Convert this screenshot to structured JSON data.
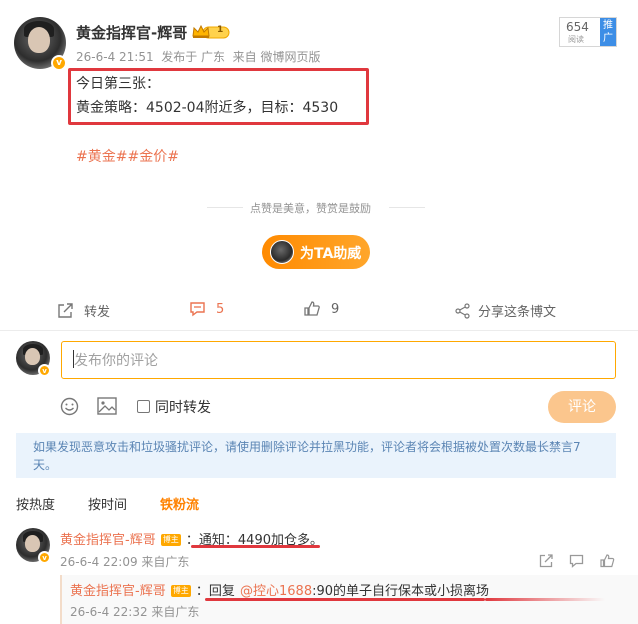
{
  "post": {
    "author": "黄金指挥官-辉哥",
    "crown_level": "1",
    "verified_mark": "v",
    "meta": "26-6-4 21:51  发布于 广东  来自 微博网页版",
    "read_count": "654",
    "read_label": "阅读",
    "push_label": "推广",
    "text_line1": "今日第三张：",
    "text_line2": "黄金策略：4502-04附近多，目标：4530",
    "hashtags": "#黄金##金价#",
    "praise_text": "点赞是美意，赞赏是鼓励",
    "help_button": "为TA助威"
  },
  "actions": {
    "forward": "转发",
    "comments": "5",
    "likes": "9",
    "share": "分享这条博文"
  },
  "composer": {
    "placeholder": "发布你的评论",
    "also_forward": "同时转发",
    "submit": "评论"
  },
  "notice": "如果发现恶意攻击和垃圾骚扰评论，请使用删除评论并拉黑功能，评论者将会根据被处置次数最长禁言7天。",
  "tabs": {
    "hot": "按热度",
    "time": "按时间",
    "fans": "铁粉流"
  },
  "comment": {
    "author": "黄金指挥官-辉哥",
    "tag": "博主",
    "colon": "：",
    "text": "通知：4490加仓多。",
    "meta": "26-6-4 22:09 来自广东"
  },
  "reply": {
    "author": "黄金指挥官-辉哥",
    "tag": "博主",
    "prefix": "：回复",
    "mention": "@控心1688",
    "text": ":90的单子自行保本或小损离场",
    "meta": "26-6-4 22:32 来自广东"
  },
  "colors": {
    "accent": "#ff8200",
    "link": "#eb7350",
    "highlight_frame": "#e0383e",
    "notice_bg": "#eaf3fc"
  }
}
